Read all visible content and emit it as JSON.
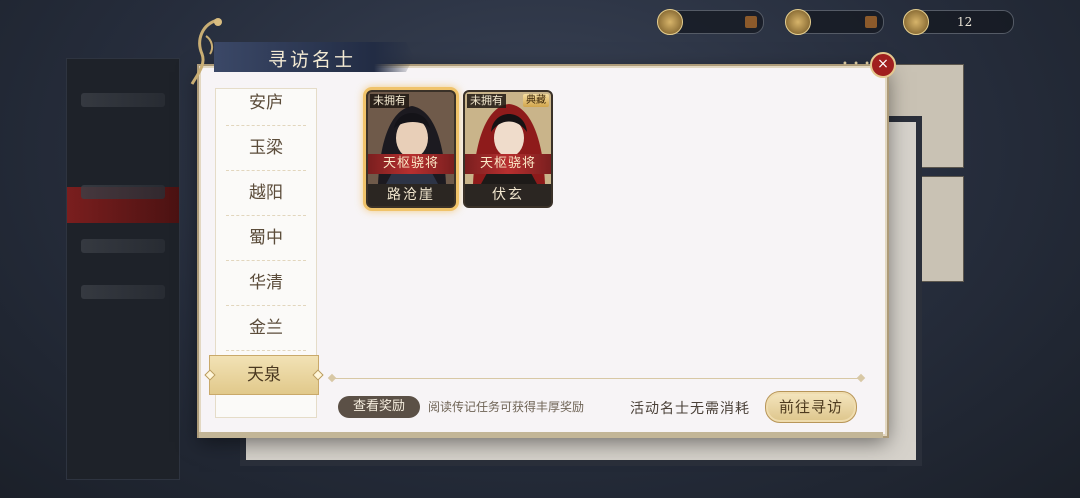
{
  "topbar": {
    "resource_1": "",
    "resource_2": "",
    "resource_3": "12"
  },
  "dialog": {
    "title": "寻访名士",
    "close_label": "×"
  },
  "regions": {
    "items": [
      "安庐",
      "玉梁",
      "越阳",
      "蜀中",
      "华清",
      "金兰"
    ],
    "active": "天泉"
  },
  "cards": [
    {
      "owned_tag": "未拥有",
      "rank": "天枢骁将",
      "name": "路沧崖",
      "badge": "",
      "selected": true
    },
    {
      "owned_tag": "未拥有",
      "rank": "天枢骁将",
      "name": "伏玄",
      "badge": "典藏",
      "selected": false
    }
  ],
  "footer": {
    "reward_button": "查看奖励",
    "reward_hint": "阅读传记任务可获得丰厚奖励",
    "cost_text": "活动名士无需消耗",
    "go_button": "前往寻访"
  },
  "colors": {
    "accent_gold": "#ddc58b",
    "rank_red": "#b72f2f",
    "close_red": "#a01f1f"
  }
}
